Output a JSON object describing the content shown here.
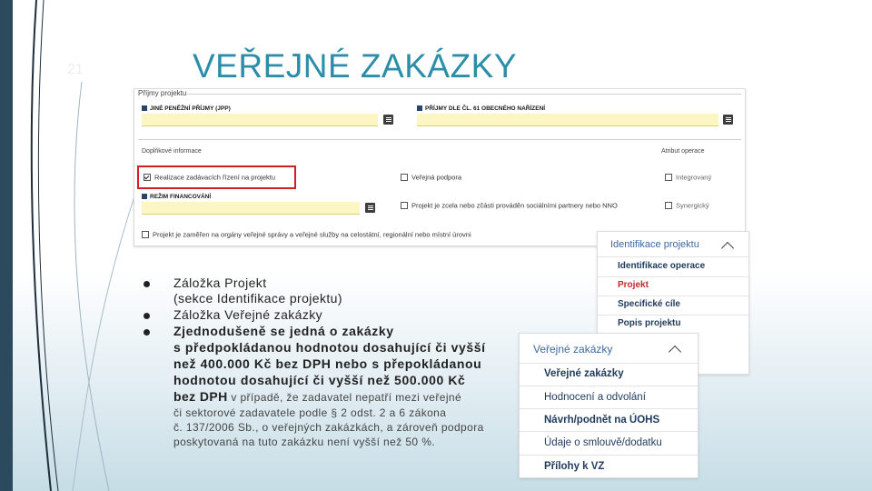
{
  "slide": {
    "number": "21",
    "title": "VEŘEJNÉ ZAKÁZKY"
  },
  "form": {
    "section_legend": "Příjmy projektu",
    "field_jpp": "JINÉ PENĚŽNÍ PŘÍJMY (JPP)",
    "field_prijmy_obecne": "PŘÍJMY DLE ČL. 61 OBECNÉHO NAŘÍZENÍ",
    "doplnkove": "Doplňkové informace",
    "atribut": "Atribut operace",
    "cb_realizace": "Realizace zadávacích řízení na projektu",
    "cb_verejna_podpora": "Veřejná podpora",
    "cb_integrovany": "Integrovaný",
    "field_rezim": "REŽIM FINANCOVÁNÍ",
    "cb_projekt_zcela": "Projekt je zcela nebo zčásti prováděn sociálními partnery nebo NNO",
    "cb_synergicky": "Synergický",
    "cb_organy": "Projekt je zaměřen na orgány veřejné správy a veřejné služby na celostátní, regionální nebo místní úrovni"
  },
  "panel_identifikace": {
    "header": "Identifikace projektu",
    "items": [
      {
        "label": "Identifikace operace"
      },
      {
        "label": "Projekt"
      },
      {
        "label": "Specifické cíle"
      },
      {
        "label": "Popis projektu"
      }
    ]
  },
  "panel_zakazky": {
    "header": "Veřejné zakázky",
    "items": [
      {
        "label": "Veřejné zakázky"
      },
      {
        "label": "Hodnocení a odvolání"
      },
      {
        "label": "Návrh/podnět na ÚOHS"
      },
      {
        "label": "Údaje o smlouvě/dodatku"
      },
      {
        "label": "Přílohy k VZ"
      }
    ]
  },
  "bullets": {
    "b1_line1": "Záložka Projekt",
    "b1_line2": "(sekce Identifikace projektu)",
    "b2": "Záložka Veřejné zakázky",
    "b3_line1": "Zjednodušeně se jedná o zakázky",
    "b3_line2": "s předpokládanou hodnotou dosahující či vyšší",
    "b3_line3": "než 400.000 Kč bez DPH nebo s přepokládanou",
    "b3_line4": "hodnotou dosahující či vyšší než 500.000 Kč",
    "b3_line5_bold": "bez DPH",
    "b3_line5_rest": " v případě, že zadavatel nepatří mezi veřejné",
    "b3_line6": "či sektorové zadavatele podle § 2 odst. 2 a 6 zákona",
    "b3_line7": "č. 137/2006 Sb., o veřejných zakázkách, a zároveň podpora",
    "b3_line8": "poskytovaná na tuto zakázku není vyšší než 50 %."
  },
  "colors": {
    "title": "#2a8ea8",
    "highlight_red": "#d21f1f",
    "active_item": "#c62828",
    "field_yellow": "#fcf7c2"
  }
}
